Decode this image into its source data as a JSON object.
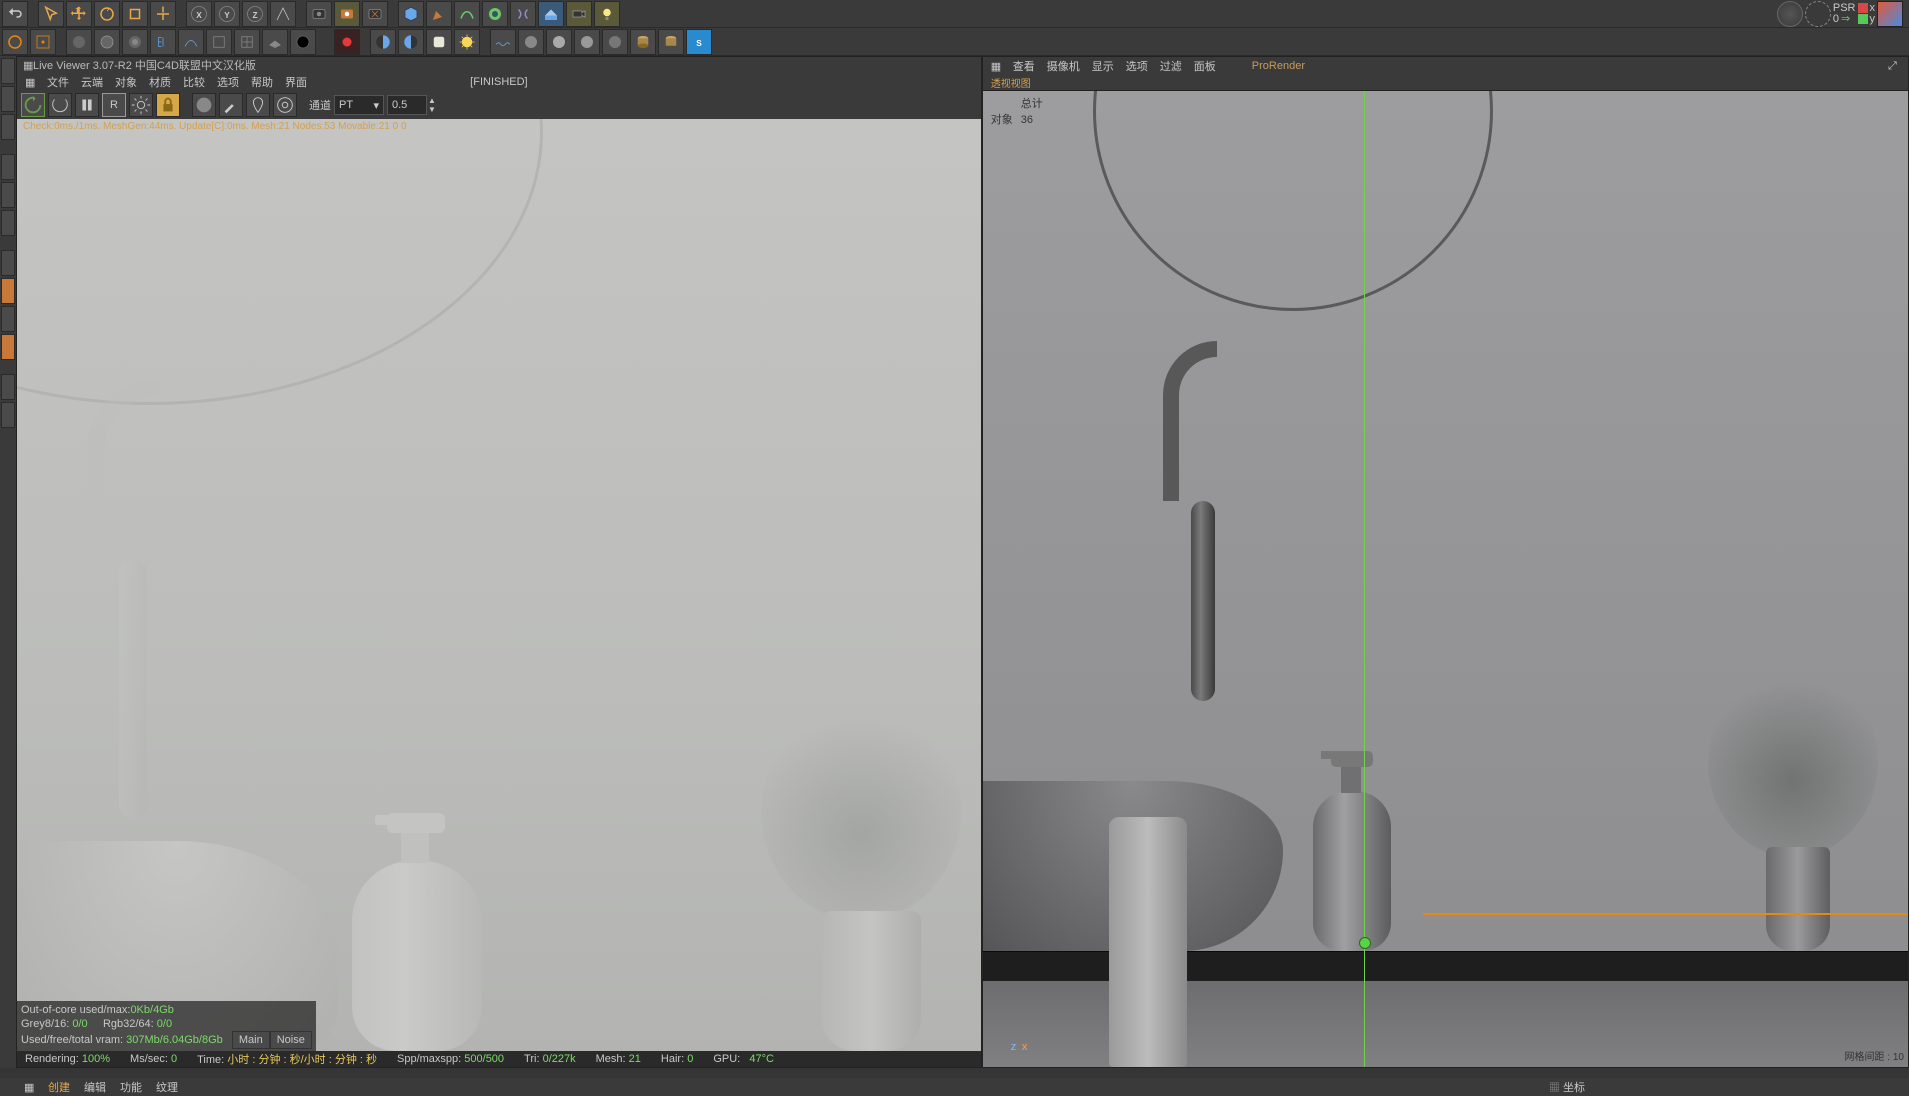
{
  "top_right": {
    "psr_label": "PSR",
    "psr_value": "0",
    "xyz": [
      "x",
      "y",
      "z"
    ]
  },
  "live_viewer": {
    "title": "Live Viewer 3.07-R2 中国C4D联盟中文汉化版",
    "menu": [
      "文件",
      "云端",
      "对象",
      "材质",
      "比较",
      "选项",
      "帮助",
      "界面"
    ],
    "status_label": "[FINISHED]",
    "channel_label": "通道",
    "channel_value": "PT",
    "channel_opacity": "0.5",
    "debug": "Check:0ms./1ms. MeshGen:44ms. Update[C]:0ms. Mesh:21 Nodes:53 Movable:21  0 0",
    "stats": {
      "ooc": "Out-of-core used/max:",
      "ooc_val": "0Kb/4Gb",
      "grey": "Grey8/16: ",
      "grey_val": "0/0",
      "rgb": "Rgb32/64: ",
      "rgb_val": "0/0",
      "vram": "Used/free/total vram: ",
      "vram_val": "307Mb/6.04Gb/8Gb",
      "tab_main": "Main",
      "tab_noise": "Noise"
    }
  },
  "perspective": {
    "menu": [
      "查看",
      "摄像机",
      "显示",
      "选项",
      "过滤",
      "面板"
    ],
    "prorender": "ProRender",
    "chip": "透视视图",
    "hud": {
      "row1_label": "总计",
      "row2_label": "对象",
      "row2_val": "36"
    },
    "grid_label": "网格间距 : 10",
    "axes": {
      "z": "z",
      "x": "x"
    }
  },
  "render_bar": {
    "rendering": "Rendering:",
    "rendering_val": "100%",
    "mssec": "Ms/sec:",
    "mssec_val": "0",
    "time": "Time:",
    "time_val": "小时 : 分钟 : 秒/小时 : 分钟 : 秒",
    "spp": "Spp/maxspp:",
    "spp_val": "500/500",
    "tri": "Tri:",
    "tri_val": "0/227k",
    "mesh": "Mesh:",
    "mesh_val": "21",
    "hair": "Hair:",
    "hair_val": "0",
    "gpu": "GPU:",
    "gpu_val": "47°C"
  },
  "bottom_menu": [
    "创建",
    "编辑",
    "功能",
    "纹理"
  ],
  "bottom_right": "坐标"
}
